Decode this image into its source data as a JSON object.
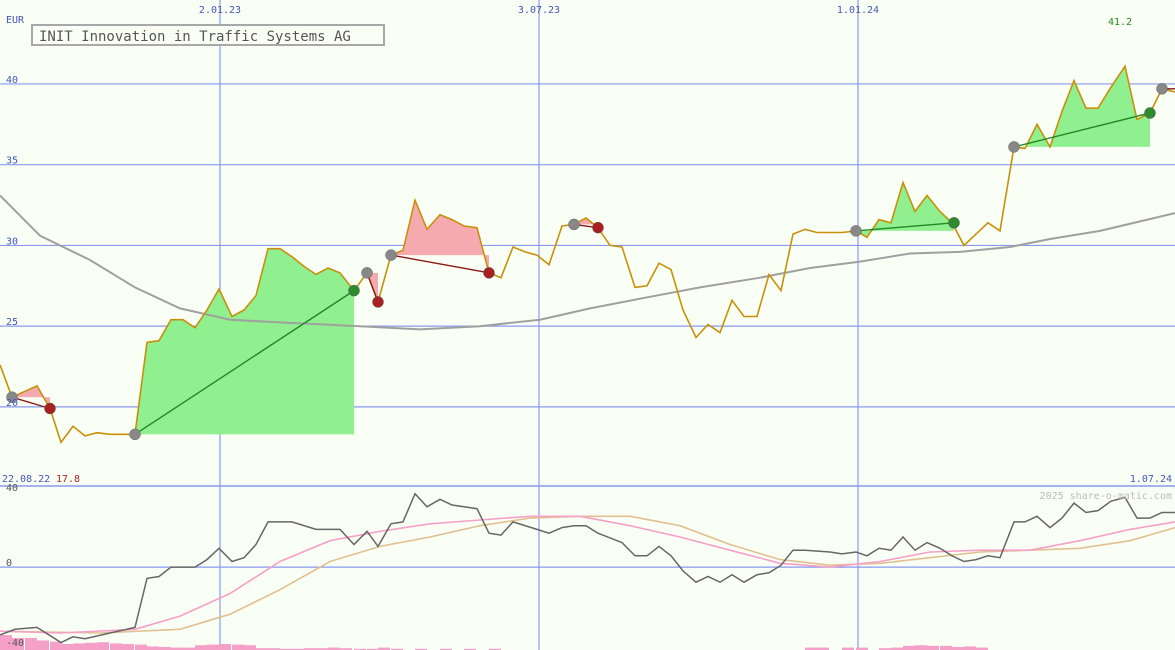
{
  "title": "INIT Innovation in Traffic Systems AG",
  "currency": "EUR",
  "copyright": "2025 share-o-matic.com",
  "start_date": "22.08.22",
  "end_date": "1.07.24",
  "min_label": "17.8",
  "max_label": "41.2",
  "colors": {
    "background": "#fafff5",
    "price": "#c8900a",
    "sma": "#a0a0a0",
    "gain_fill": "#90f090",
    "loss_fill": "#f5aab0",
    "grid": "#8899ee",
    "axis_text": "#4455bb",
    "max_text": "#228822",
    "min_text": "#aa2222",
    "osc": "#666666",
    "osc_pink": "#f5a0c8",
    "osc_tan": "#e0c090"
  },
  "chart_data": {
    "type": "line",
    "x_tick_labels": [
      "2.01.23",
      "3.07.23",
      "1.01.24"
    ],
    "y_ticks": [
      20,
      25,
      30,
      35,
      40
    ],
    "ylim": [
      15.1,
      45.2
    ],
    "price": [
      [
        0,
        22.6
      ],
      [
        12,
        20.6
      ],
      [
        37,
        21.3
      ],
      [
        50,
        19.9
      ],
      [
        61,
        17.8
      ],
      [
        73,
        18.8
      ],
      [
        85,
        18.2
      ],
      [
        97,
        18.4
      ],
      [
        110,
        18.3
      ],
      [
        122,
        18.3
      ],
      [
        135,
        18.3
      ],
      [
        147,
        24.0
      ],
      [
        159,
        24.1
      ],
      [
        171,
        25.4
      ],
      [
        183,
        25.4
      ],
      [
        195,
        24.9
      ],
      [
        207,
        26.0
      ],
      [
        219,
        27.3
      ],
      [
        232,
        25.6
      ],
      [
        244,
        26.0
      ],
      [
        256,
        26.9
      ],
      [
        268,
        29.8
      ],
      [
        280,
        29.8
      ],
      [
        292,
        29.3
      ],
      [
        304,
        28.7
      ],
      [
        316,
        28.2
      ],
      [
        328,
        28.6
      ],
      [
        340,
        28.3
      ],
      [
        354,
        27.2
      ],
      [
        367,
        28.3
      ],
      [
        378,
        26.5
      ],
      [
        391,
        29.4
      ],
      [
        403,
        29.7
      ],
      [
        415,
        32.8
      ],
      [
        427,
        31.0
      ],
      [
        440,
        31.9
      ],
      [
        452,
        31.6
      ],
      [
        464,
        31.2
      ],
      [
        477,
        31.1
      ],
      [
        489,
        28.3
      ],
      [
        501,
        28.0
      ],
      [
        513,
        29.9
      ],
      [
        525,
        29.6
      ],
      [
        537,
        29.4
      ],
      [
        549,
        28.8
      ],
      [
        562,
        31.2
      ],
      [
        574,
        31.3
      ],
      [
        586,
        31.7
      ],
      [
        598,
        31.1
      ],
      [
        610,
        30.0
      ],
      [
        622,
        29.9
      ],
      [
        635,
        27.4
      ],
      [
        647,
        27.5
      ],
      [
        659,
        28.9
      ],
      [
        671,
        28.5
      ],
      [
        683,
        26.0
      ],
      [
        696,
        24.3
      ],
      [
        708,
        25.1
      ],
      [
        720,
        24.6
      ],
      [
        732,
        26.6
      ],
      [
        744,
        25.6
      ],
      [
        757,
        25.6
      ],
      [
        769,
        28.2
      ],
      [
        781,
        27.2
      ],
      [
        793,
        30.7
      ],
      [
        805,
        31.0
      ],
      [
        817,
        30.8
      ],
      [
        830,
        30.8
      ],
      [
        842,
        30.8
      ],
      [
        856,
        30.9
      ],
      [
        867,
        30.5
      ],
      [
        879,
        31.6
      ],
      [
        891,
        31.4
      ],
      [
        903,
        33.9
      ],
      [
        915,
        32.1
      ],
      [
        927,
        33.1
      ],
      [
        940,
        32.1
      ],
      [
        952,
        31.4
      ],
      [
        964,
        30.0
      ],
      [
        976,
        30.7
      ],
      [
        988,
        31.4
      ],
      [
        1000,
        30.9
      ],
      [
        1014,
        36.1
      ],
      [
        1025,
        36.0
      ],
      [
        1037,
        37.5
      ],
      [
        1050,
        36.1
      ],
      [
        1062,
        38.3
      ],
      [
        1074,
        40.2
      ],
      [
        1086,
        38.5
      ],
      [
        1098,
        38.5
      ],
      [
        1111,
        39.8
      ],
      [
        1125,
        41.1
      ],
      [
        1137,
        37.8
      ],
      [
        1150,
        38.2
      ],
      [
        1162,
        39.7
      ],
      [
        1175,
        39.5
      ]
    ],
    "sma": [
      [
        0,
        33.1
      ],
      [
        40,
        30.6
      ],
      [
        90,
        29.1
      ],
      [
        135,
        27.4
      ],
      [
        180,
        26.1
      ],
      [
        230,
        25.4
      ],
      [
        290,
        25.2
      ],
      [
        360,
        25.0
      ],
      [
        420,
        24.8
      ],
      [
        480,
        25.0
      ],
      [
        540,
        25.4
      ],
      [
        590,
        26.1
      ],
      [
        640,
        26.7
      ],
      [
        700,
        27.4
      ],
      [
        760,
        28.0
      ],
      [
        810,
        28.6
      ],
      [
        860,
        29.0
      ],
      [
        910,
        29.5
      ],
      [
        960,
        29.6
      ],
      [
        1010,
        29.9
      ],
      [
        1050,
        30.4
      ],
      [
        1100,
        30.9
      ],
      [
        1175,
        32.0
      ]
    ],
    "trades": [
      {
        "buy": [
          12,
          20.6
        ],
        "sell": [
          50,
          19.9
        ],
        "gain": false
      },
      {
        "buy": [
          135,
          18.3
        ],
        "sell": [
          354,
          27.2
        ],
        "gain": true
      },
      {
        "buy": [
          367,
          28.3
        ],
        "sell": [
          378,
          26.5
        ],
        "gain": false
      },
      {
        "buy": [
          391,
          29.4
        ],
        "sell": [
          489,
          28.3
        ],
        "gain": false
      },
      {
        "buy": [
          574,
          31.3
        ],
        "sell": [
          598,
          31.1
        ],
        "gain": false
      },
      {
        "buy": [
          856,
          30.9
        ],
        "sell": [
          954,
          31.4
        ],
        "gain": true
      },
      {
        "buy": [
          1014,
          36.1
        ],
        "sell": [
          1150,
          38.2
        ],
        "gain": true
      },
      {
        "buy": [
          1162,
          39.7
        ],
        "sell": null,
        "gain": false
      }
    ],
    "indicator": {
      "y_ticks": [
        40,
        0,
        -40
      ],
      "ylim": [
        -44,
        42
      ],
      "line": [
        [
          0,
          -36
        ],
        [
          15,
          -33
        ],
        [
          37,
          -32
        ],
        [
          61,
          -40
        ],
        [
          73,
          -37
        ],
        [
          85,
          -38
        ],
        [
          110,
          -35
        ],
        [
          135,
          -32
        ],
        [
          147,
          -6
        ],
        [
          159,
          -5
        ],
        [
          171,
          0
        ],
        [
          195,
          0
        ],
        [
          207,
          4
        ],
        [
          219,
          10
        ],
        [
          232,
          3
        ],
        [
          244,
          5
        ],
        [
          256,
          12
        ],
        [
          268,
          24
        ],
        [
          292,
          24
        ],
        [
          316,
          20
        ],
        [
          340,
          20
        ],
        [
          354,
          12
        ],
        [
          367,
          19
        ],
        [
          378,
          11
        ],
        [
          391,
          23
        ],
        [
          403,
          24
        ],
        [
          415,
          39
        ],
        [
          427,
          32
        ],
        [
          440,
          36
        ],
        [
          452,
          33
        ],
        [
          477,
          31
        ],
        [
          489,
          18
        ],
        [
          501,
          17
        ],
        [
          513,
          24
        ],
        [
          537,
          20
        ],
        [
          549,
          18
        ],
        [
          562,
          21
        ],
        [
          574,
          22
        ],
        [
          586,
          22
        ],
        [
          598,
          18
        ],
        [
          622,
          13
        ],
        [
          635,
          6
        ],
        [
          647,
          6
        ],
        [
          659,
          11
        ],
        [
          671,
          6
        ],
        [
          683,
          -2
        ],
        [
          696,
          -8
        ],
        [
          708,
          -5
        ],
        [
          720,
          -8
        ],
        [
          732,
          -4
        ],
        [
          744,
          -8
        ],
        [
          757,
          -4
        ],
        [
          769,
          -3
        ],
        [
          781,
          1
        ],
        [
          793,
          9
        ],
        [
          805,
          9
        ],
        [
          830,
          8
        ],
        [
          842,
          7
        ],
        [
          856,
          8
        ],
        [
          867,
          6
        ],
        [
          879,
          10
        ],
        [
          891,
          9
        ],
        [
          903,
          16
        ],
        [
          915,
          9
        ],
        [
          927,
          13
        ],
        [
          940,
          10
        ],
        [
          952,
          6
        ],
        [
          964,
          3
        ],
        [
          976,
          4
        ],
        [
          988,
          6
        ],
        [
          1000,
          5
        ],
        [
          1014,
          24
        ],
        [
          1025,
          24
        ],
        [
          1037,
          27
        ],
        [
          1050,
          21
        ],
        [
          1062,
          26
        ],
        [
          1074,
          34
        ],
        [
          1086,
          29
        ],
        [
          1098,
          30
        ],
        [
          1111,
          35
        ],
        [
          1125,
          37
        ],
        [
          1137,
          26
        ],
        [
          1150,
          26
        ],
        [
          1162,
          29
        ],
        [
          1175,
          29
        ]
      ],
      "pink": [
        [
          0,
          -34
        ],
        [
          60,
          -35
        ],
        [
          135,
          -33
        ],
        [
          180,
          -26
        ],
        [
          230,
          -14
        ],
        [
          280,
          3
        ],
        [
          330,
          14
        ],
        [
          380,
          19
        ],
        [
          430,
          23
        ],
        [
          480,
          25
        ],
        [
          530,
          27
        ],
        [
          580,
          27
        ],
        [
          630,
          22
        ],
        [
          680,
          16
        ],
        [
          730,
          9
        ],
        [
          780,
          2
        ],
        [
          830,
          0
        ],
        [
          880,
          3
        ],
        [
          930,
          8
        ],
        [
          980,
          9
        ],
        [
          1030,
          9
        ],
        [
          1080,
          14
        ],
        [
          1130,
          20
        ],
        [
          1175,
          24
        ]
      ],
      "tan": [
        [
          0,
          -34
        ],
        [
          100,
          -35
        ],
        [
          180,
          -33
        ],
        [
          230,
          -25
        ],
        [
          280,
          -12
        ],
        [
          330,
          3
        ],
        [
          380,
          11
        ],
        [
          430,
          16
        ],
        [
          480,
          22
        ],
        [
          530,
          26
        ],
        [
          580,
          27
        ],
        [
          630,
          27
        ],
        [
          680,
          22
        ],
        [
          730,
          12
        ],
        [
          780,
          4
        ],
        [
          830,
          1
        ],
        [
          880,
          2
        ],
        [
          930,
          5
        ],
        [
          980,
          8
        ],
        [
          1030,
          9
        ],
        [
          1080,
          10
        ],
        [
          1130,
          14
        ],
        [
          1175,
          21
        ]
      ],
      "bars_label": "volume",
      "bars": [
        [
          0,
          2.5
        ],
        [
          12,
          2.0
        ],
        [
          25,
          2.0
        ],
        [
          37,
          1.6
        ],
        [
          50,
          1.4
        ],
        [
          61,
          1.0
        ],
        [
          73,
          1.1
        ],
        [
          85,
          1.2
        ],
        [
          97,
          1.3
        ],
        [
          110,
          1.1
        ],
        [
          122,
          1.0
        ],
        [
          135,
          0.9
        ],
        [
          147,
          0.6
        ],
        [
          159,
          0.5
        ],
        [
          171,
          0.4
        ],
        [
          183,
          0.4
        ],
        [
          195,
          0.8
        ],
        [
          207,
          0.9
        ],
        [
          219,
          1.0
        ],
        [
          232,
          0.9
        ],
        [
          244,
          0.8
        ],
        [
          256,
          0.3
        ],
        [
          268,
          0.3
        ],
        [
          280,
          0.2
        ],
        [
          292,
          0.2
        ],
        [
          304,
          0.3
        ],
        [
          316,
          0.3
        ],
        [
          328,
          0.4
        ],
        [
          340,
          0.3
        ],
        [
          354,
          0.2
        ],
        [
          367,
          0.2
        ],
        [
          378,
          0.4
        ],
        [
          391,
          0.2
        ],
        [
          415,
          0.2
        ],
        [
          440,
          0.2
        ],
        [
          464,
          0.2
        ],
        [
          489,
          0.2
        ],
        [
          805,
          0.4
        ],
        [
          817,
          0.4
        ],
        [
          842,
          0.4
        ],
        [
          856,
          0.4
        ],
        [
          879,
          0.3
        ],
        [
          891,
          0.4
        ],
        [
          903,
          0.7
        ],
        [
          915,
          0.8
        ],
        [
          927,
          0.7
        ],
        [
          940,
          0.7
        ],
        [
          952,
          0.5
        ],
        [
          964,
          0.6
        ],
        [
          976,
          0.4
        ]
      ]
    }
  }
}
